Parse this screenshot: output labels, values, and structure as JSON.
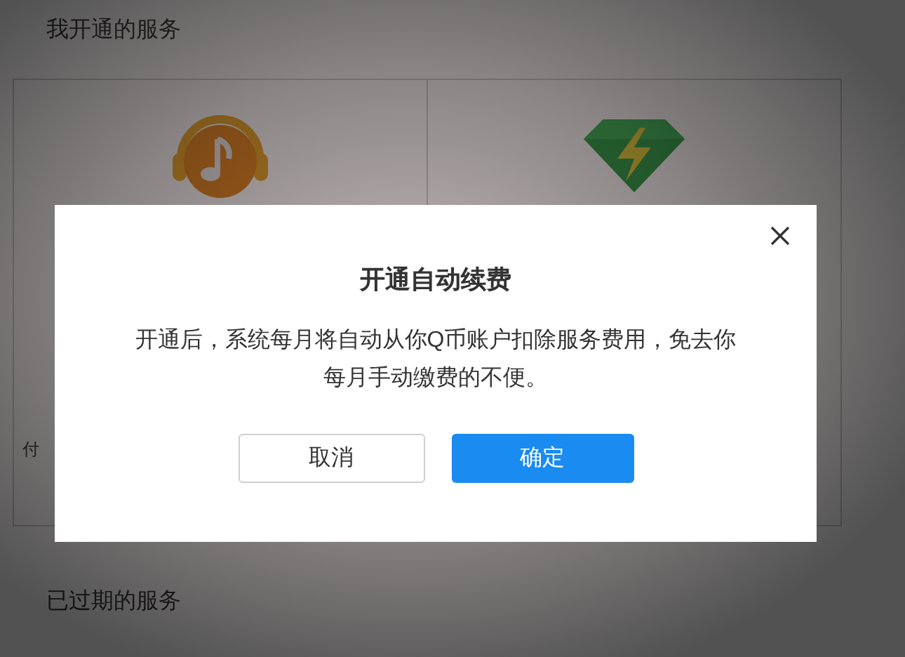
{
  "page": {
    "active_heading": "我开通的服务",
    "card_caption": "付",
    "expired_heading": "已过期的服务"
  },
  "dialog": {
    "title": "开通自动续费",
    "message": "开通后，系统每月将自动从你Q币账户扣除服务费用，免去你每月手动缴费的不便。",
    "buttons": [
      {
        "label": "取消",
        "kind": "secondary"
      },
      {
        "label": "确定",
        "kind": "primary"
      }
    ]
  }
}
